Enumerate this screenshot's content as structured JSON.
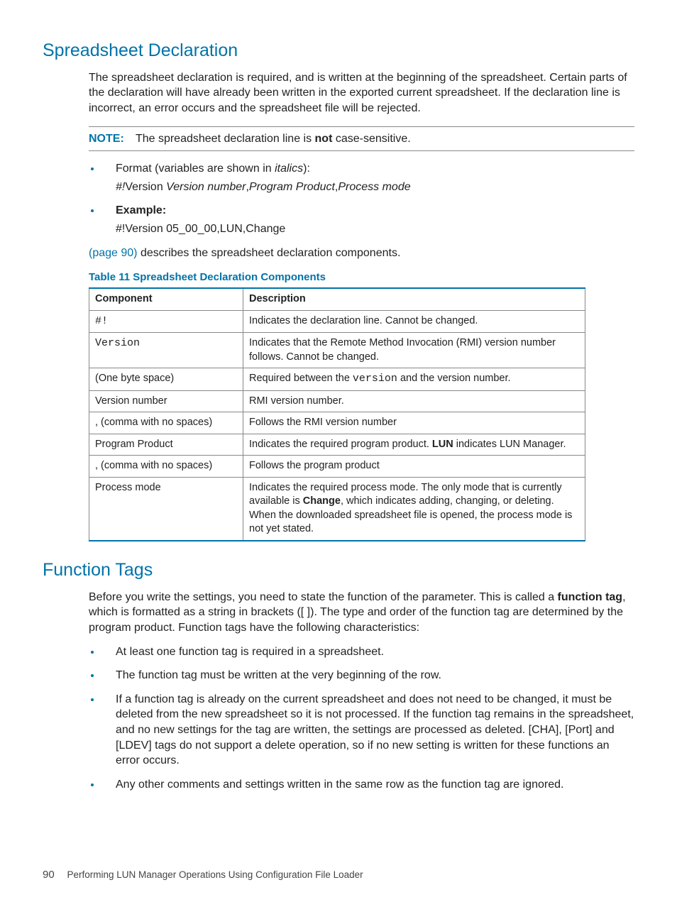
{
  "sections": {
    "s1": {
      "title": "Spreadsheet Declaration",
      "intro": "The spreadsheet declaration is required, and is written at the beginning of the spreadsheet. Certain parts of the declaration will have already been written in the exported current spreadsheet. If the declaration line is incorrect, an error occurs and the spreadsheet file will be rejected.",
      "note_label": "NOTE:",
      "note_pre": "The spreadsheet declaration line is ",
      "note_bold": "not",
      "note_post": " case-sensitive.",
      "format_lead": "Format (variables are shown in ",
      "format_lead_italic": "italics",
      "format_lead_end": "):",
      "format_line_pre": "#!",
      "format_line_txt1": "Version ",
      "format_line_var1": "Version number",
      "format_line_c1": ",",
      "format_line_var2": "Program Product",
      "format_line_c2": ",",
      "format_line_var3": "Process mode",
      "example_label": "Example:",
      "example_line": "#!Version 05_00_00,LUN,Change",
      "pre_ref": "(page 90)",
      "post_ref": " describes the spreadsheet declaration components.",
      "table_caption": "Table 11 Spreadsheet Declaration Components",
      "th1": "Component",
      "th2": "Description",
      "rows": [
        {
          "c": "#!",
          "c_mono": true,
          "d_pre": "Indicates the declaration line. Cannot be changed."
        },
        {
          "c": "Version",
          "c_mono": true,
          "d_pre": "Indicates that the Remote Method Invocation (RMI) version number follows. Cannot be changed."
        },
        {
          "c": "(One byte space)",
          "d_pre": "Required between the ",
          "d_code": "version",
          "d_post": " and the version number."
        },
        {
          "c": "Version number",
          "d_pre": "RMI version number."
        },
        {
          "c": ", (comma with no spaces)",
          "d_pre": "Follows the RMI version number"
        },
        {
          "c": "Program Product",
          "d_pre": "Indicates the required program product. ",
          "d_bold": "LUN",
          "d_post": " indicates LUN Manager."
        },
        {
          "c": ", (comma with no spaces)",
          "d_pre": "Follows the program product"
        },
        {
          "c": "Process mode",
          "d_pre": "Indicates the required process mode. The only mode that is currently available is ",
          "d_bold": "Change",
          "d_post": ", which indicates adding, changing, or deleting. When the downloaded spreadsheet file is opened, the process mode is not yet stated."
        }
      ]
    },
    "s2": {
      "title": "Function Tags",
      "intro_pre": "Before you write the settings, you need to state the function of the parameter. This is called a ",
      "intro_bold": "function tag",
      "intro_post": ", which is formatted as a string in brackets ([ ]). The type and order of the function tag are determined by the program product. Function tags have the following characteristics:",
      "bullets": [
        "At least one function tag is required in a spreadsheet.",
        "The function tag must be written at the very beginning of the row.",
        "If a function tag is already on the current spreadsheet and does not need to be changed, it must be deleted from the new spreadsheet so it is not processed. If the function tag remains in the spreadsheet, and no new settings for the tag are written, the settings are processed as deleted. [CHA], [Port] and [LDEV] tags do not support a delete operation, so if no new setting is written for these functions an error occurs.",
        "Any other comments and settings written in the same row as the function tag are ignored."
      ]
    }
  },
  "footer": {
    "page": "90",
    "chapter": "Performing LUN Manager Operations Using Configuration File Loader"
  }
}
